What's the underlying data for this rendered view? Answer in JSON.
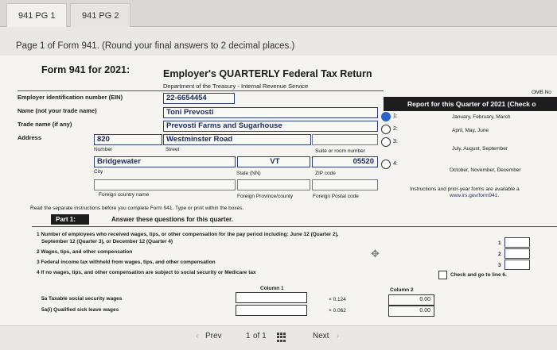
{
  "tabs": [
    {
      "label": "941 PG 1"
    },
    {
      "label": "941 PG 2"
    }
  ],
  "page_title": "Page 1 of Form 941. (Round your final answers to 2 decimal places.)",
  "form": {
    "name": "Form 941 for 2021:",
    "title": "Employer's QUARTERLY Federal Tax Return",
    "dept": "Department of the Treasury - Internal Revenue Service",
    "omb": "OMB No"
  },
  "employer": {
    "ein_label": "Employer identification number (EIN)",
    "ein": "22-6654454",
    "name_label": "Name (not your trade name)",
    "name": "Toni Prevosti",
    "trade_label": "Trade name (if any)",
    "trade": "Prevosti Farms and Sugarhouse",
    "address_label": "Address",
    "number": "820",
    "street": "Westminster Road",
    "number_label": "Number",
    "street_label": "Street",
    "suite_label": "Suite or room number",
    "city": "Bridgewater",
    "state": "VT",
    "zip": "05520",
    "city_label": "City",
    "state_label": "State (NN)",
    "zip_label": "ZIP code",
    "foreign_country_label": "Foreign country name",
    "foreign_province_label": "Foreign Province/county",
    "foreign_postal_label": "Foreign Postal code"
  },
  "report": {
    "title": "Report for this Quarter of 2021 (Check o",
    "quarters": [
      {
        "num": "1:",
        "text": "January, February, March",
        "selected": true
      },
      {
        "num": "2:",
        "text": "April, May, June",
        "selected": false
      },
      {
        "num": "3:",
        "text": "July, August, September",
        "selected": false
      },
      {
        "num": "4:",
        "text": "October, November, December",
        "selected": false
      }
    ],
    "instructions_1": "Instructions and prior-year forms are available a",
    "instructions_2": "www.irs.gov/form941."
  },
  "read_instructions": "Read the separate instructions before you complete Form 941. Type or print within the boxes.",
  "part1": {
    "label": "Part 1:",
    "text": "Answer these questions for this quarter.",
    "q1_a": "1  Number of employees who received wages, tips, or other compensation for the pay period including: June 12 (Quarter 2),",
    "q1_b": "September 12 (Quarter 3), or December 12 (Quarter 4)",
    "q2": "2  Wages, tips, and other compensation",
    "q3": "3  Federal income tax withheld from wages, tips, and other compensation",
    "q4": "4  If no wages, tips, and other compensation are subject to social security or Medicare tax",
    "q4_check": "Check and go to line 6.",
    "line_nums": [
      "1",
      "2",
      "3"
    ],
    "column1": "Column 1",
    "column2": "Column 2",
    "q5a": "5a Taxable social security wages",
    "q5ai": "5a(i) Qualified sick leave wages",
    "rate_5a": "× 0.124",
    "rate_5ai": "× 0.062",
    "value_5a": "0.00",
    "value_5ai": "0.00"
  },
  "pager": {
    "prev": "Prev",
    "page": "1",
    "of": "of 1",
    "next": "Next"
  }
}
